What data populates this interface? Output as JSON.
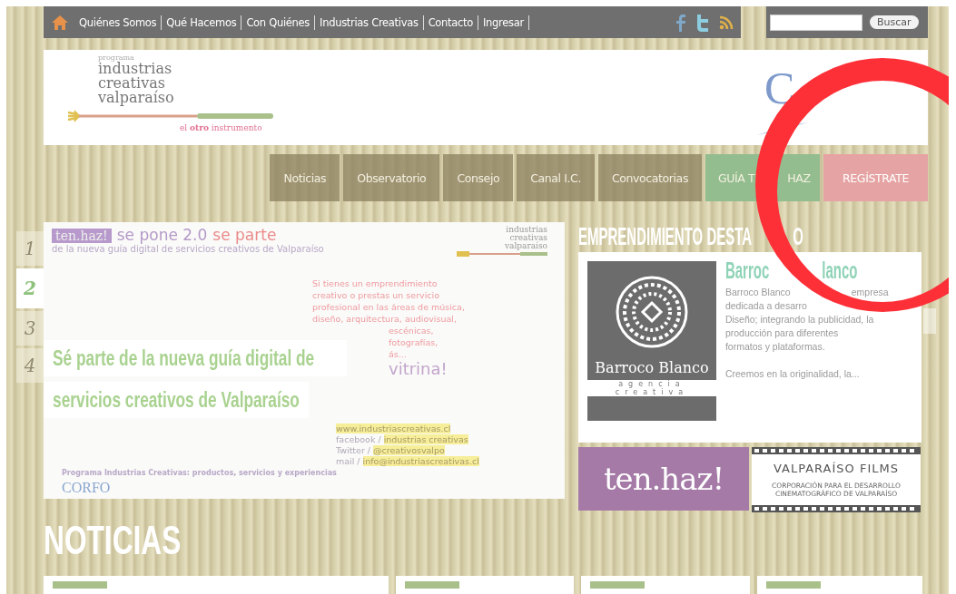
{
  "top_nav": {
    "items": [
      "Quiénes Somos",
      "Qué Hacemos",
      "Con Quiénes",
      "Industrias Creativas",
      "Contacto",
      "Ingresar"
    ]
  },
  "search": {
    "button": "Buscar"
  },
  "header": {
    "logo": {
      "small": "programa",
      "lines": [
        "industrias",
        "creativas",
        "valparaíso"
      ],
      "tagline": "el **otro** instrumento"
    },
    "partner_logo": "C"
  },
  "main_nav": [
    {
      "parts": [
        "Noticias"
      ],
      "kind": "plain"
    },
    {
      "parts": [
        "Observatorio"
      ],
      "kind": "plain"
    },
    {
      "parts": [
        "Consejo"
      ],
      "kind": "plain"
    },
    {
      "parts": [
        "Canal I.C."
      ],
      "kind": "plain"
    },
    {
      "parts": [
        "Convocatorias"
      ],
      "kind": "plain"
    },
    {
      "parts": [
        "GUÍA T",
        "HAZ"
      ],
      "kind": "green"
    },
    {
      "parts": [
        "REGÍSTRATE"
      ],
      "kind": "pink"
    }
  ],
  "slider": {
    "tabs": [
      {
        "label": "1",
        "selected": false
      },
      {
        "label": "2",
        "selected": true
      },
      {
        "label": "3",
        "selected": false
      },
      {
        "label": "4",
        "selected": false
      }
    ],
    "banner": {
      "brand": "ten.haz!",
      "headline": "se pone 2.0",
      "highlight": "se parte",
      "subline": "de la nueva guía digital de servicios creativos de Valparaíso",
      "logo_lines": [
        "industrias",
        "creativas",
        "valparaíso"
      ],
      "body_lines": [
        "Si tienes un emprendimiento",
        "creativo o prestas un servicio",
        "profesional en las áreas de música,",
        "diseño, arquitectura, audiovisual,",
        "escénicas,",
        "fotografías,",
        "ás..."
      ],
      "tail": "vitrina!",
      "contacts": [
        {
          "label": "www.industriascreativas.cl"
        },
        {
          "prefix": "facebook /",
          "label": "industrias creativas"
        },
        {
          "prefix": "Twitter /",
          "label": "@creativosvalpo"
        },
        {
          "prefix": "mail /",
          "label": "info@industriascreativas.cl"
        }
      ],
      "footer": "Programa Industrias Creativas: productos, servicios y experiencias",
      "footer_logo": "CORFO"
    },
    "caption": [
      "Sé parte de la nueva guía digital de",
      "servicios creativos de Valparaíso"
    ]
  },
  "featured": {
    "heading_parts": [
      "EMPRENDIMIENTO DESTA",
      "O"
    ],
    "logo_name": "Barroco Blanco",
    "logo_sub": "agencia creativa",
    "title_parts": [
      "Barroc",
      "lanco"
    ],
    "description_lines": [
      [
        "Barroco Blanco",
        "empresa"
      ],
      [
        "dedicada a desarro"
      ],
      [
        "Diseño; integrando la publicidad, la"
      ],
      [
        "producción para diferentes"
      ],
      [
        "formatos y plataformas."
      ]
    ],
    "more": "Creemos en la originalidad, la..."
  },
  "partners": [
    {
      "kind": "tenhaz",
      "label": "ten.haz!"
    },
    {
      "kind": "films",
      "label": "VALPARAÍSO FILMS",
      "sub": "CORPORACIÓN PARA EL DESARROLLO CINEMATOGRÁFICO DE VALPARAÍSO"
    }
  ],
  "news": {
    "heading": "NOTICIAS"
  }
}
